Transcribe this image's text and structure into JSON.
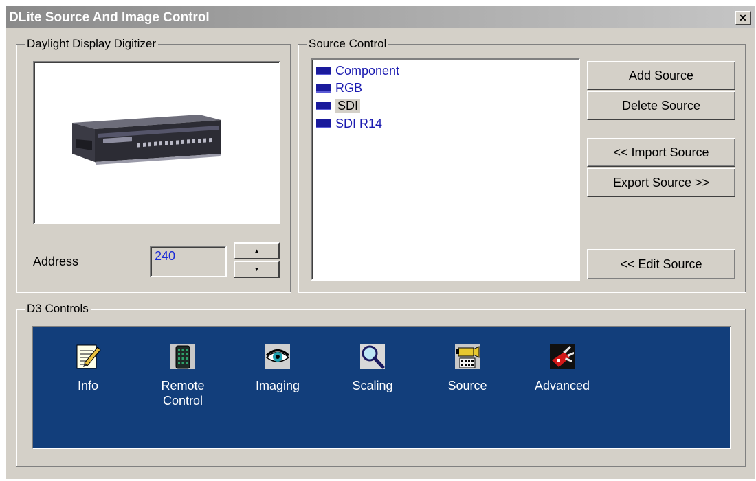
{
  "window": {
    "title": "DLite Source And Image Control",
    "close_glyph": "✕"
  },
  "digitizer_group": {
    "legend": "Daylight Display Digitizer",
    "address_label": "Address",
    "address_value": "240",
    "spin_up_glyph": "▲",
    "spin_down_glyph": "▼"
  },
  "source_group": {
    "legend": "Source Control",
    "sources": [
      {
        "label": "Component",
        "selected": false
      },
      {
        "label": "RGB",
        "selected": false
      },
      {
        "label": "SDI",
        "selected": true
      },
      {
        "label": "SDI R14",
        "selected": false
      }
    ],
    "buttons": {
      "add": "Add Source",
      "delete": "Delete Source",
      "import": "<< Import Source",
      "export": "Export Source >>",
      "edit": "<< Edit  Source"
    }
  },
  "d3_group": {
    "legend": "D3 Controls",
    "tools": [
      {
        "label": "Info",
        "icon": "notepad-pencil-icon"
      },
      {
        "label": "Remote Control",
        "icon": "remote-control-icon"
      },
      {
        "label": "Imaging",
        "icon": "eye-icon"
      },
      {
        "label": "Scaling",
        "icon": "magnifier-icon"
      },
      {
        "label": "Source",
        "icon": "video-camera-icon"
      },
      {
        "label": "Advanced",
        "icon": "swiss-knife-icon"
      }
    ]
  },
  "colors": {
    "panel_blue": "#123e7b",
    "list_text": "#1a1ab0",
    "address_text": "#1a2bd6"
  }
}
